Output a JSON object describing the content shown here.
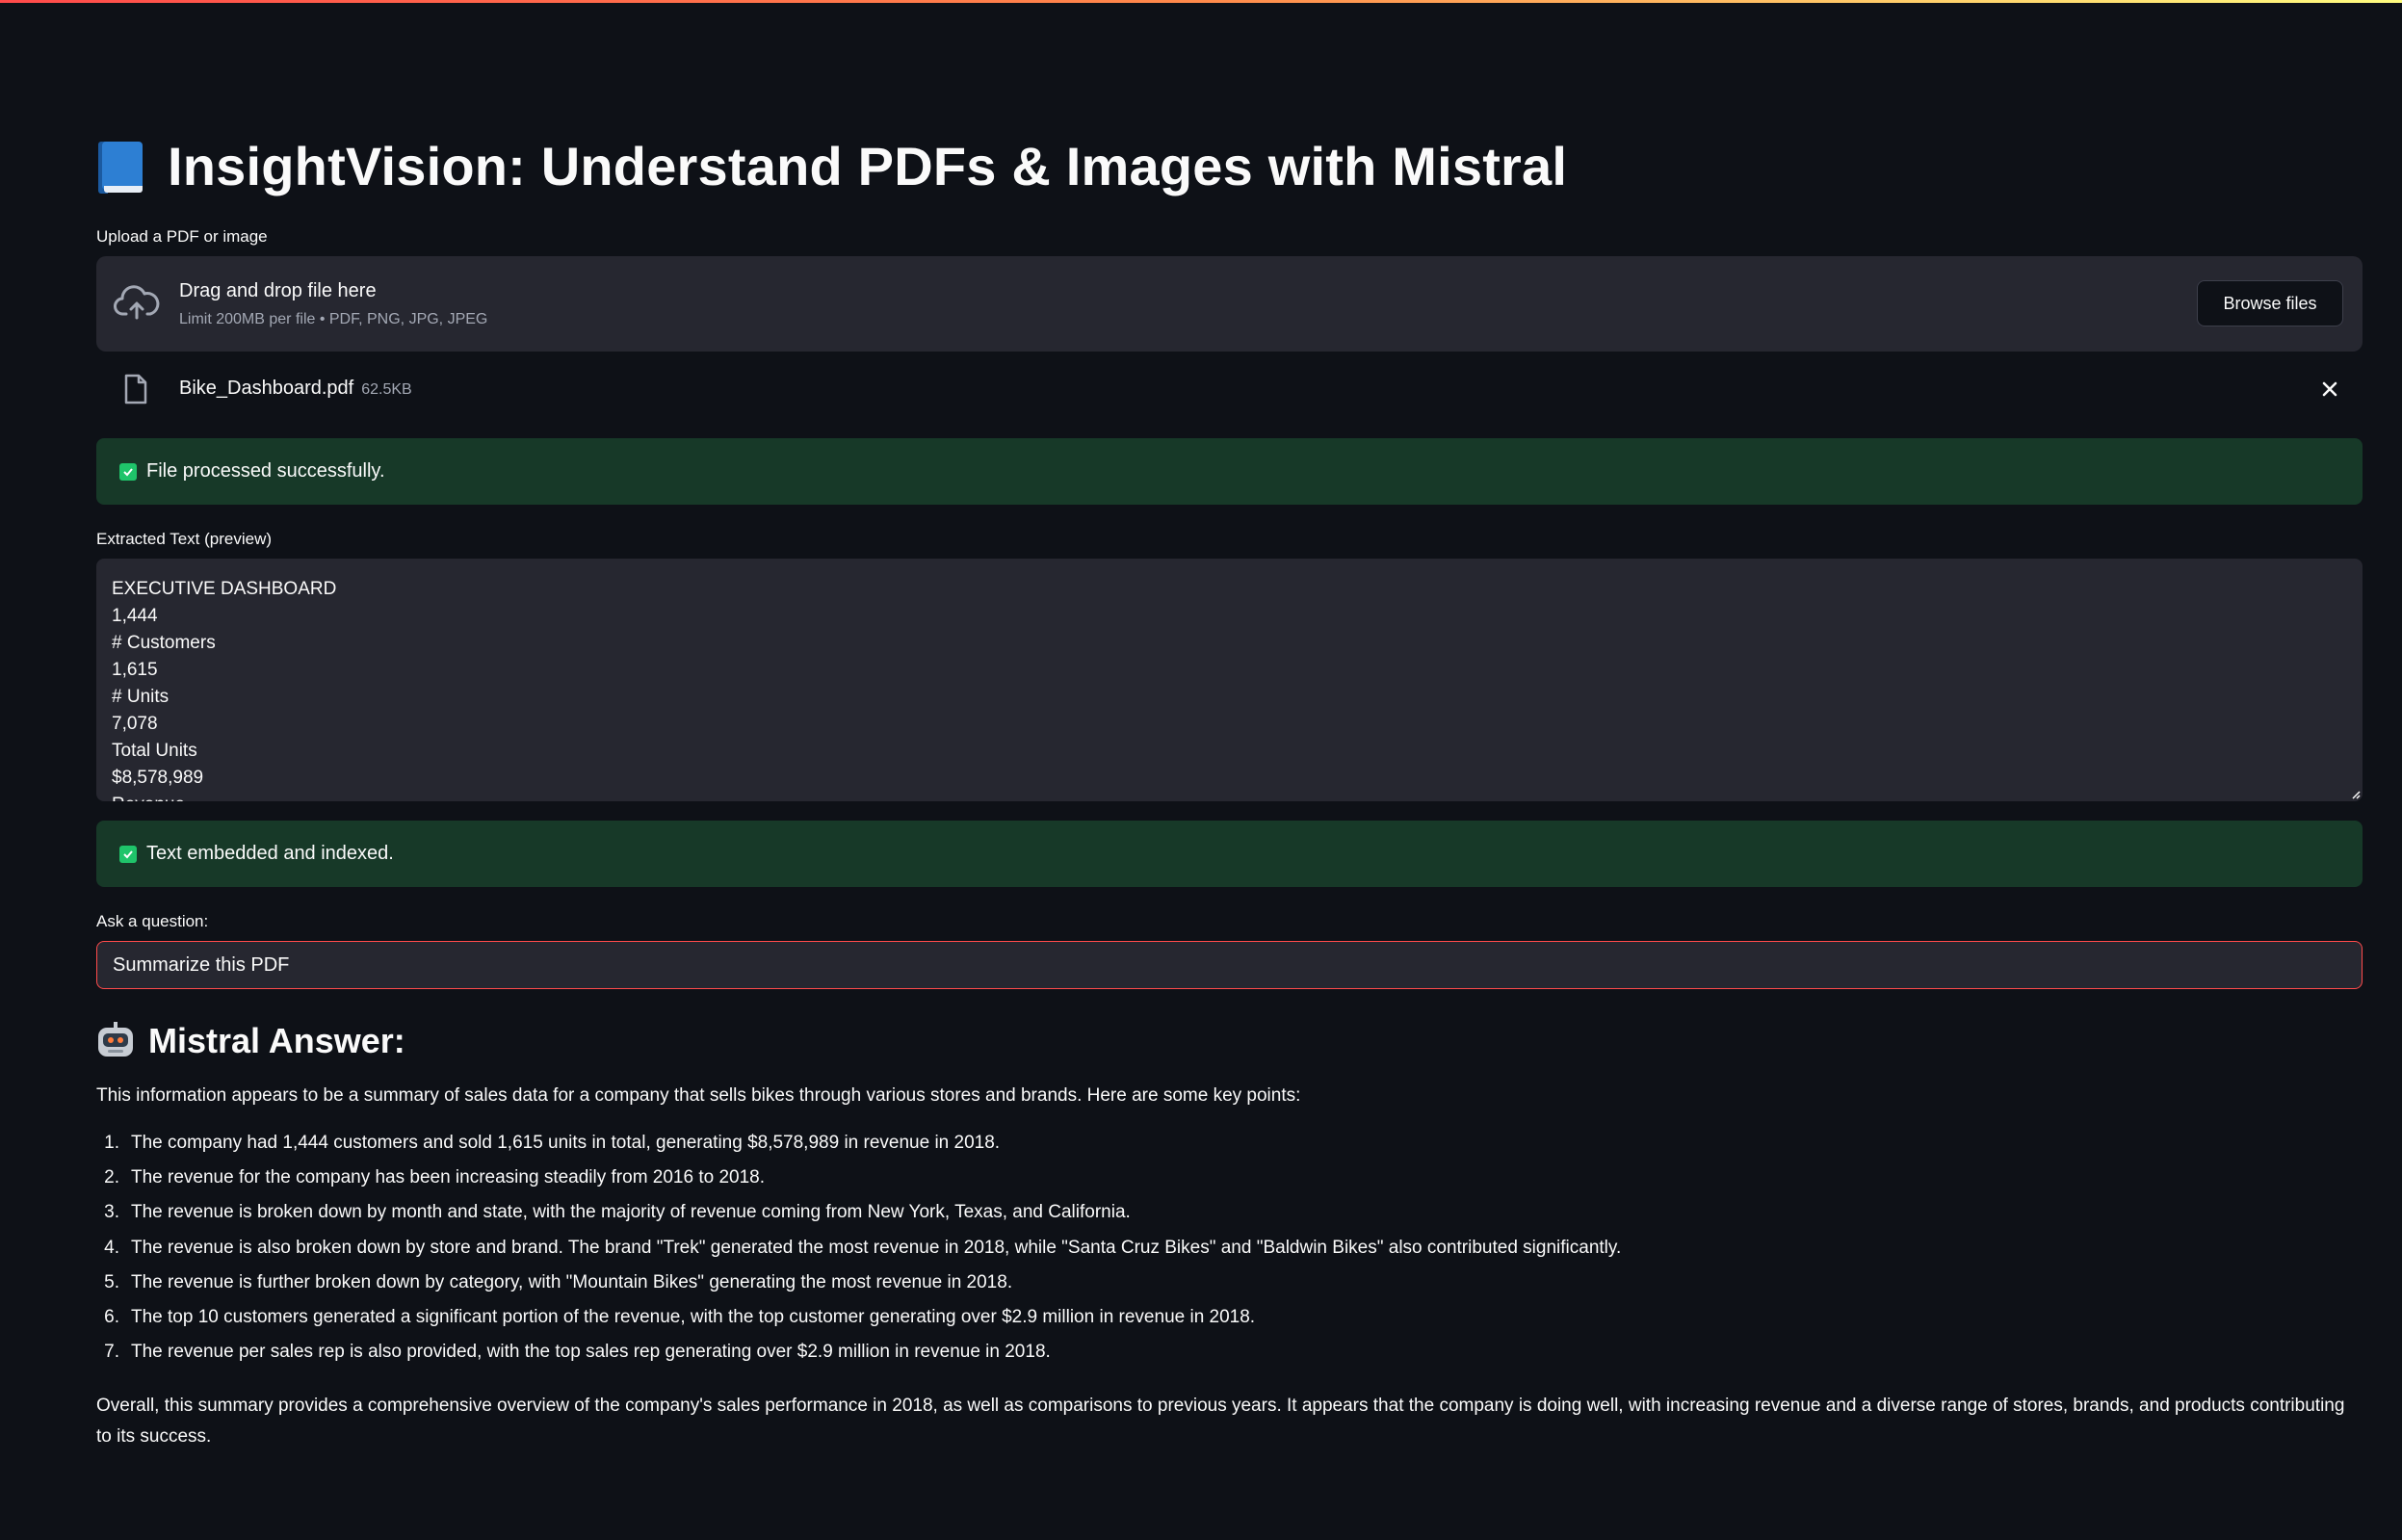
{
  "page": {
    "title": "InsightVision: Understand PDFs & Images with Mistral",
    "title_icon": "blue-book-icon"
  },
  "uploader": {
    "label": "Upload a PDF or image",
    "drag_text": "Drag and drop file here",
    "limit_text": "Limit 200MB per file • PDF, PNG, JPG, JPEG",
    "browse_label": "Browse files",
    "file": {
      "name": "Bike_Dashboard.pdf",
      "size": "62.5KB"
    }
  },
  "status": {
    "processed": "File processed successfully.",
    "indexed": "Text embedded and indexed."
  },
  "extracted": {
    "label": "Extracted Text (preview)",
    "lines": [
      "EXECUTIVE DASHBOARD",
      "1,444",
      "# Customers",
      "1,615",
      "# Units",
      "7,078",
      "Total Units",
      "$8,578,989",
      "Revenue"
    ]
  },
  "question": {
    "label": "Ask a question:",
    "value": "Summarize this PDF"
  },
  "answer": {
    "heading": "Mistral Answer:",
    "intro": "This information appears to be a summary of sales data for a company that sells bikes through various stores and brands. Here are some key points:",
    "points": [
      "The company had 1,444 customers and sold 1,615 units in total, generating $8,578,989 in revenue in 2018.",
      "The revenue for the company has been increasing steadily from 2016 to 2018.",
      "The revenue is broken down by month and state, with the majority of revenue coming from New York, Texas, and California.",
      "The revenue is also broken down by store and brand. The brand \"Trek\" generated the most revenue in 2018, while \"Santa Cruz Bikes\" and \"Baldwin Bikes\" also contributed significantly.",
      "The revenue is further broken down by category, with \"Mountain Bikes\" generating the most revenue in 2018.",
      "The top 10 customers generated a significant portion of the revenue, with the top customer generating over $2.9 million in revenue in 2018.",
      "The revenue per sales rep is also provided, with the top sales rep generating over $2.9 million in revenue in 2018."
    ],
    "numbers": [
      "1.",
      "2.",
      "3.",
      "4.",
      "5.",
      "6.",
      "7."
    ],
    "outro": "Overall, this summary provides a comprehensive overview of the company's sales performance in 2018, as well as comparisons to previous years. It appears that the company is doing well, with increasing revenue and a diverse range of stores, brands, and products contributing to its success."
  },
  "colors": {
    "background": "#0e1117",
    "surface": "#262730",
    "success_bg": "#173928",
    "accent_red": "#ff4b4b"
  }
}
